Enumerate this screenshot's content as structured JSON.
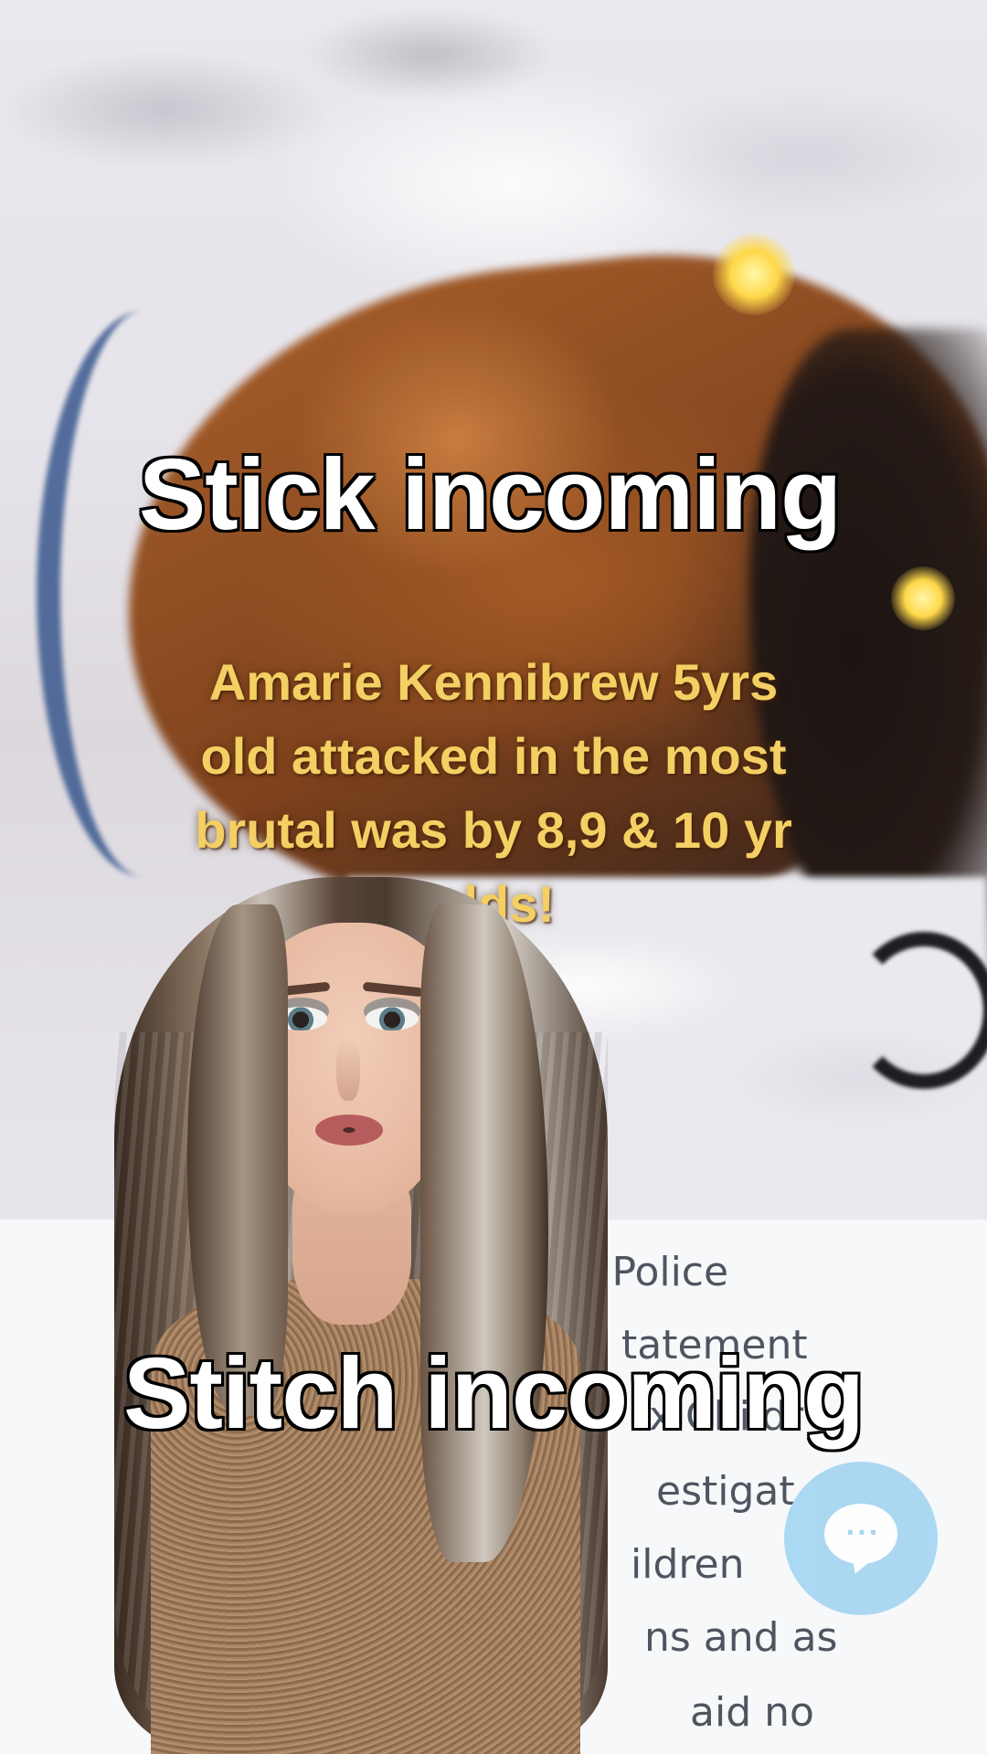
{
  "captions": {
    "top": "Stick incoming",
    "bottom": "Stitch incoming"
  },
  "video_overlay": {
    "text": "Amarie Kennibrew 5yrs\nold attacked in the most\nbrutal was by 8,9 & 10 yr\nolds!"
  },
  "document_fragments": [
    {
      "text": "f Police"
    },
    {
      "text": "tatement"
    },
    {
      "text": "x Childr"
    },
    {
      "text": "estigat"
    },
    {
      "text": "ildren"
    },
    {
      "text": "ns and as"
    },
    {
      "text": "aid no"
    }
  ],
  "chat_button": {
    "icon": "chat-bubble-icon",
    "glyph": "···",
    "color": "#a7d6f1"
  },
  "colors": {
    "overlay_text": "#f4cf63",
    "caption_text": "#ffffff",
    "caption_outline": "#000000"
  }
}
